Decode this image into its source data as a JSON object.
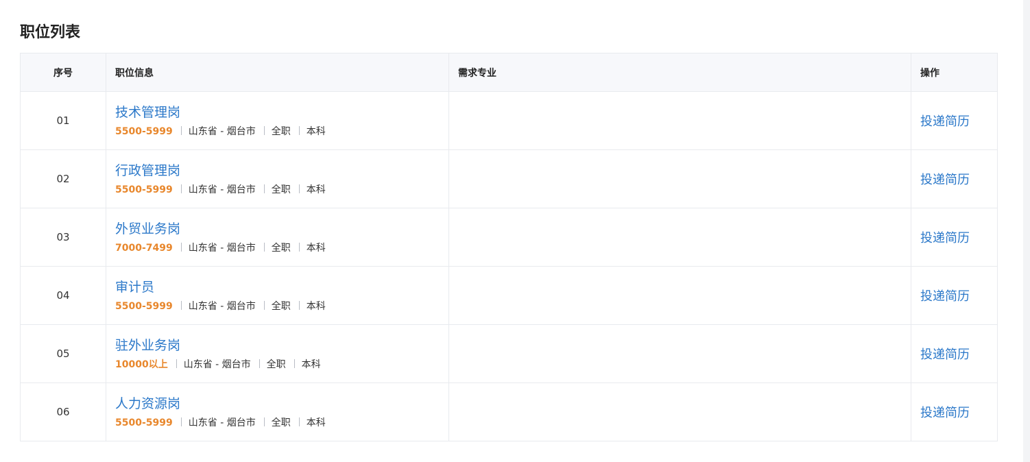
{
  "page": {
    "title": "职位列表"
  },
  "table": {
    "headers": {
      "no": "序号",
      "info": "职位信息",
      "major": "需求专业",
      "action": "操作"
    },
    "rows": [
      {
        "no": "01",
        "title": "技术管理岗",
        "salary": "5500-5999",
        "location": "山东省 - 烟台市",
        "type": "全职",
        "education": "本科",
        "major": "",
        "action": "投递简历"
      },
      {
        "no": "02",
        "title": "行政管理岗",
        "salary": "5500-5999",
        "location": "山东省 - 烟台市",
        "type": "全职",
        "education": "本科",
        "major": "",
        "action": "投递简历"
      },
      {
        "no": "03",
        "title": "外贸业务岗",
        "salary": "7000-7499",
        "location": "山东省 - 烟台市",
        "type": "全职",
        "education": "本科",
        "major": "",
        "action": "投递简历"
      },
      {
        "no": "04",
        "title": "审计员",
        "salary": "5500-5999",
        "location": "山东省 - 烟台市",
        "type": "全职",
        "education": "本科",
        "major": "",
        "action": "投递简历"
      },
      {
        "no": "05",
        "title": "驻外业务岗",
        "salary": "10000以上",
        "location": "山东省 - 烟台市",
        "type": "全职",
        "education": "本科",
        "major": "",
        "action": "投递简历"
      },
      {
        "no": "06",
        "title": "人力资源岗",
        "salary": "5500-5999",
        "location": "山东省 - 烟台市",
        "type": "全职",
        "education": "本科",
        "major": "",
        "action": "投递简历"
      }
    ]
  },
  "colors": {
    "link": "#2b78c9",
    "salary": "#e8872c",
    "header_bg": "#f7f8fb",
    "border": "#e8eaee"
  }
}
